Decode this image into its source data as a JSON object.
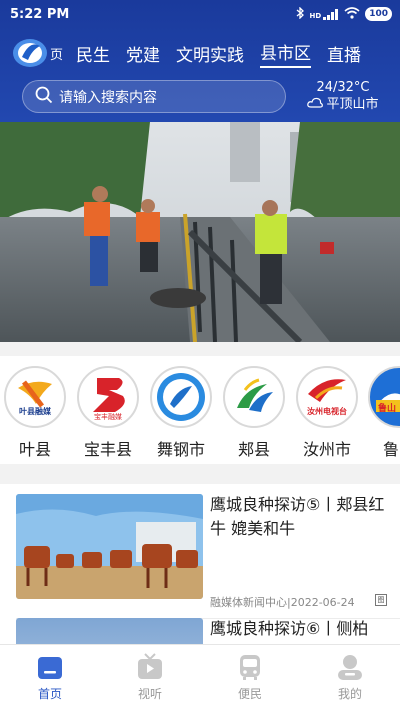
{
  "status_bar": {
    "time": "5:22 PM",
    "signal": "HD",
    "battery": "100"
  },
  "header": {
    "logo_text": "页",
    "tabs": [
      {
        "label": "民生",
        "active": false
      },
      {
        "label": "党建",
        "active": false
      },
      {
        "label": "文明实践",
        "active": false
      },
      {
        "label": "县市区",
        "active": true
      },
      {
        "label": "直播",
        "active": false
      }
    ],
    "search": {
      "placeholder": "请输入搜索内容"
    },
    "weather": {
      "temp": "24/32°C",
      "city": "平顶山市",
      "icon": "cloud-icon"
    }
  },
  "channels": [
    {
      "label": "叶县",
      "logo_text": "叶县融媒",
      "color": "#e8641b"
    },
    {
      "label": "宝丰县",
      "logo_text": "宝丰融媒",
      "color": "#d8232a"
    },
    {
      "label": "舞钢市",
      "logo_text": "",
      "color": "#1e7fd6"
    },
    {
      "label": "郏县",
      "logo_text": "",
      "color": "#2c9b47"
    },
    {
      "label": "汝州市",
      "logo_text": "汝州电视台",
      "color": "#d8232a"
    },
    {
      "label": "鲁山",
      "logo_text": "鲁山",
      "color": "#1e6fd6"
    }
  ],
  "news": [
    {
      "title": "鹰城良种探访⑤丨郏县红牛 媲美和牛",
      "source": "融媒体新闻中心",
      "date": "2022-06-24",
      "flag": "图"
    },
    {
      "title": "鹰城良种探访⑥丨侧柏",
      "source": "",
      "date": "",
      "flag": ""
    }
  ],
  "bottom_nav": [
    {
      "label": "首页",
      "icon": "home-icon",
      "active": true
    },
    {
      "label": "视听",
      "icon": "tv-icon",
      "active": false
    },
    {
      "label": "便民",
      "icon": "bus-icon",
      "active": false
    },
    {
      "label": "我的",
      "icon": "user-icon",
      "active": false
    }
  ],
  "colors": {
    "brand": "#1a3a9c",
    "active": "#2a57c4"
  }
}
